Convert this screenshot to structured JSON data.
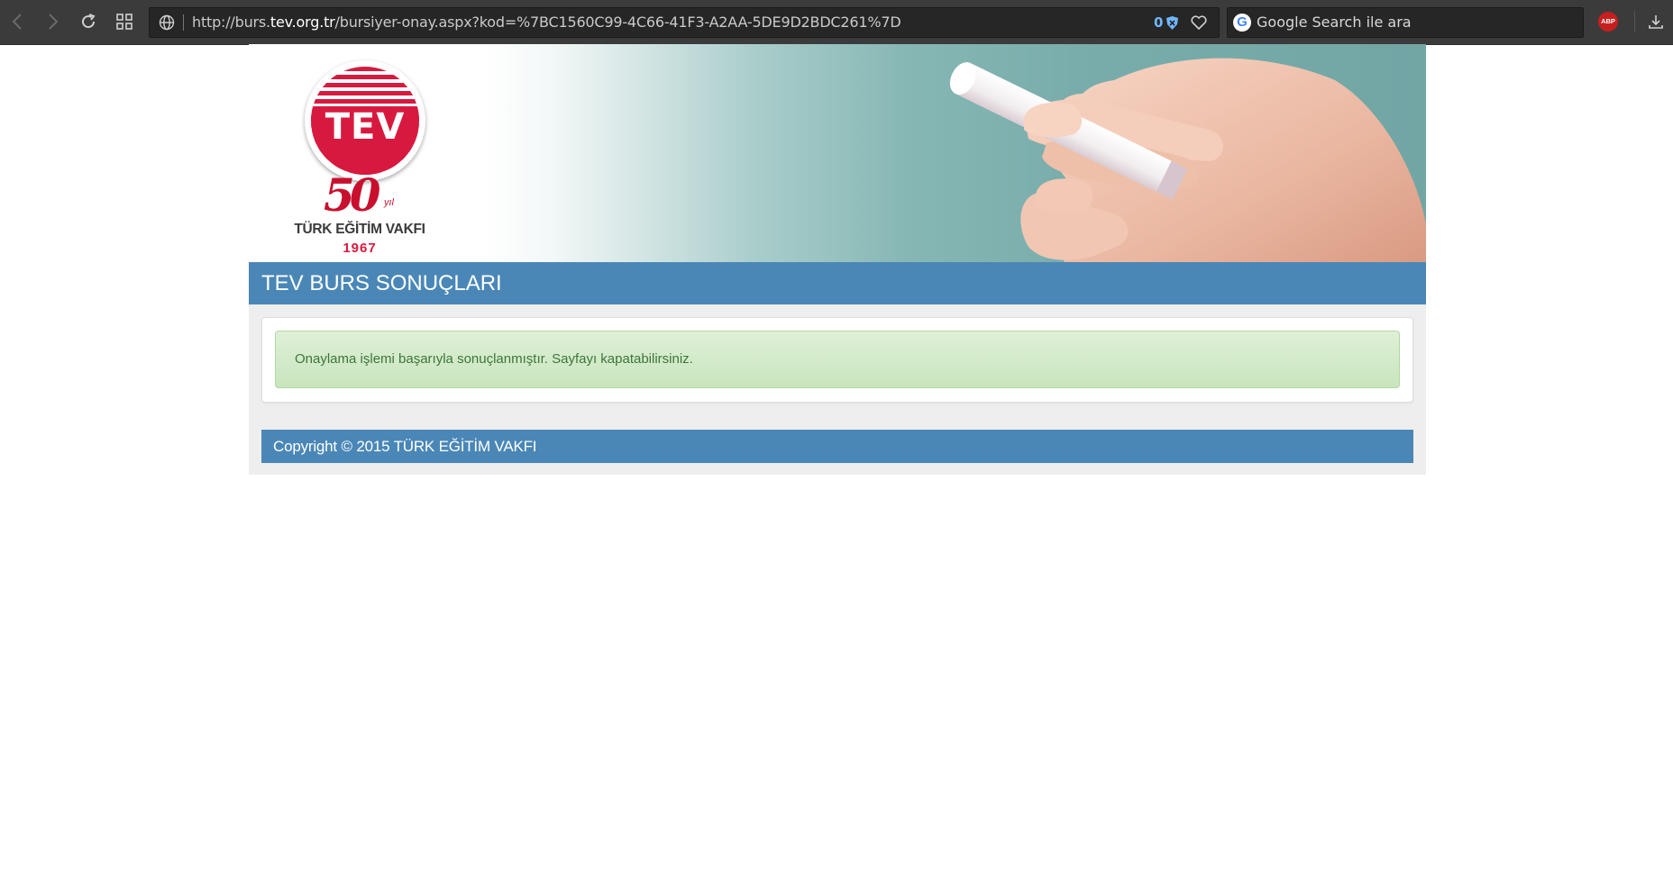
{
  "browser": {
    "url": {
      "prefix": "http://burs.",
      "domain": "tev.org.tr",
      "path": "/bursiyer-onay.aspx?kod=%7BC1560C99-4C66-41F3-A2AA-5DE9D2BDC261%7D"
    },
    "blocked_count": "0",
    "search_placeholder": "Google Search ile ara",
    "search_engine_letter": "G",
    "adblock_label": "ABP"
  },
  "banner": {
    "logo_text": "TEV",
    "logo_anniversary": "50",
    "logo_anniversary_suffix": "yıl",
    "logo_name": "TÜRK EĞİTİM VAKFI",
    "logo_year": "1967"
  },
  "page": {
    "title": "TEV BURS SONUÇLARI",
    "alert_message": "Onaylama işlemi başarıyla sonuçlanmıştır. Sayfayı kapatabilirsiniz.",
    "footer": "Copyright © 2015 TÜRK EĞİTİM VAKFI"
  },
  "colors": {
    "header_blue": "#4a87b7",
    "success_green": "#dff0d8",
    "brand_red": "#d8193f"
  },
  "icons": [
    "back-icon",
    "forward-icon",
    "reload-icon",
    "speed-dial-icon",
    "globe-icon",
    "shield-icon",
    "heart-icon",
    "download-icon"
  ]
}
